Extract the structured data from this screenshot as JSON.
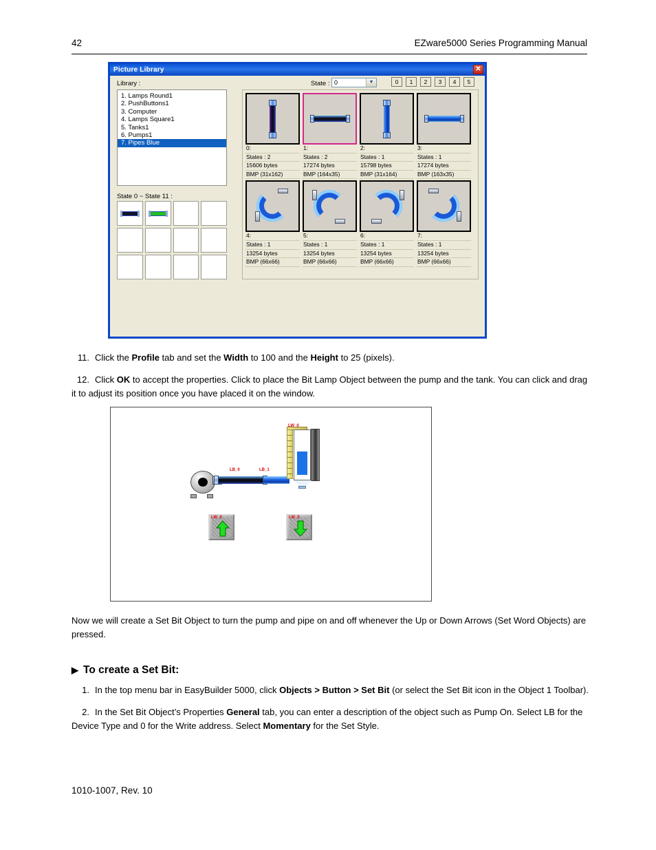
{
  "page": {
    "number": "42",
    "header_title": "EZware5000 Series Programming Manual",
    "footer": "1010-1007, Rev. 10"
  },
  "dialog": {
    "title": "Picture Library",
    "close_icon": "close-icon",
    "library_label": "Library :",
    "state_label": "State :",
    "state_value": "0",
    "state_buttons": [
      "0",
      "1",
      "2",
      "3",
      "4",
      "5"
    ],
    "library_items": [
      "1. Lamps Round1",
      "2. PushButtons1",
      "3. Computer",
      "4. Lamps Square1",
      "5. Tanks1",
      "6. Pumps1",
      "7. Pipes Blue"
    ],
    "selected_library_index": 6,
    "states_caption": "State 0 ~ State 11 :",
    "state_cells": [
      {
        "filled": true,
        "color": "#12122a"
      },
      {
        "filled": true,
        "color": "#22c022"
      },
      {
        "filled": false
      },
      {
        "filled": false
      },
      {
        "filled": false
      },
      {
        "filled": false
      },
      {
        "filled": false
      },
      {
        "filled": false
      },
      {
        "filled": false
      },
      {
        "filled": false
      },
      {
        "filled": false
      },
      {
        "filled": false
      }
    ],
    "selection_color": "#d4288c",
    "pictures": [
      {
        "index": "0:",
        "states": "States : 2",
        "bytes": "15606 bytes",
        "format": "BMP (31x162)",
        "shape": "pipe-vertical",
        "selected": false
      },
      {
        "index": "1:",
        "states": "States : 2",
        "bytes": "17274 bytes",
        "format": "BMP (164x35)",
        "shape": "pipe-horizontal",
        "selected": true
      },
      {
        "index": "2:",
        "states": "States : 1",
        "bytes": "15798 bytes",
        "format": "BMP (31x164)",
        "shape": "pipe-vertical-on",
        "selected": false
      },
      {
        "index": "3:",
        "states": "States : 1",
        "bytes": "17274 bytes",
        "format": "BMP (163x35)",
        "shape": "pipe-horizontal-on",
        "selected": false
      },
      {
        "index": "4:",
        "states": "States : 1",
        "bytes": "13254 bytes",
        "format": "BMP (66x66)",
        "shape": "elbow-1",
        "selected": false
      },
      {
        "index": "5:",
        "states": "States : 1",
        "bytes": "13254 bytes",
        "format": "BMP (66x66)",
        "shape": "elbow-2",
        "selected": false
      },
      {
        "index": "6:",
        "states": "States : 1",
        "bytes": "13254 bytes",
        "format": "BMP (66x66)",
        "shape": "elbow-3",
        "selected": false
      },
      {
        "index": "7:",
        "states": "States : 1",
        "bytes": "13254 bytes",
        "format": "BMP (66x66)",
        "shape": "elbow-4",
        "selected": false
      }
    ]
  },
  "steps_upper": {
    "item11_num": "11.",
    "item12_num": "12."
  },
  "illustration": {
    "pump_tag": "LB_0",
    "bitlamp_tag": "LB_1",
    "tank_tag": "LW_0",
    "up_button_tag": "LW_0",
    "down_button_tag": "LW_0"
  },
  "paragraph": "Now we will create a Set Bit Object to turn the pump and pipe on and off whenever the Up or Down Arrows (Set Word Objects) are pressed.",
  "section": {
    "heading": "To create a Set Bit:",
    "triangle": "▶",
    "item1_num": "1.",
    "item2_num": "2."
  }
}
